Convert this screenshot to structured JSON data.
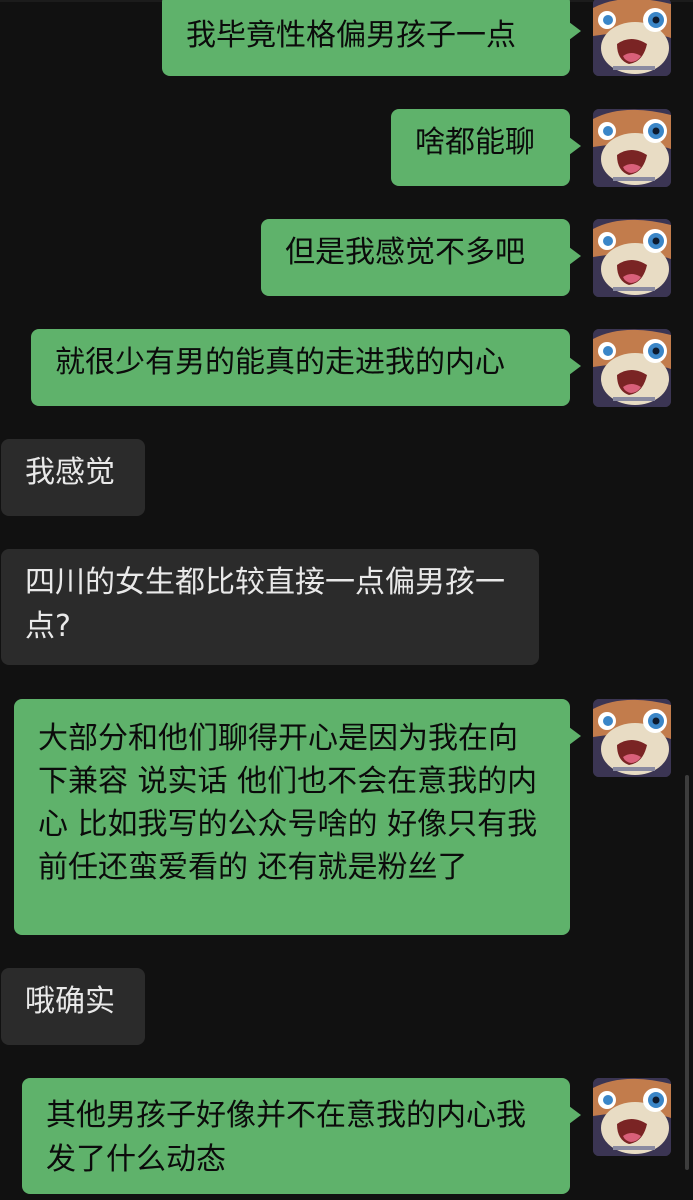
{
  "messages": [
    {
      "side": "out",
      "text": "我毕竟性格偏男孩子一点"
    },
    {
      "side": "out",
      "text": "啥都能聊"
    },
    {
      "side": "out",
      "text": "但是我感觉不多吧"
    },
    {
      "side": "out",
      "text": "就很少有男的能真的走进我的内心"
    },
    {
      "side": "in",
      "text": "我感觉"
    },
    {
      "side": "in",
      "text": "四川的女生都比较直接一点偏男孩一点?"
    },
    {
      "side": "out",
      "text": "大部分和他们聊得开心是因为我在向下兼容 说实话 他们也不会在意我的内心 比如我写的公众号啥的 好像只有我前任还蛮爱看的 还有就是粉丝了"
    },
    {
      "side": "in",
      "text": "哦确实"
    },
    {
      "side": "out",
      "text": "其他男孩子好像并不在意我的内心我发了什么动态"
    }
  ],
  "colors": {
    "background": "#111111",
    "outgoing_bubble": "#5fb26b",
    "incoming_bubble": "#2b2b2b",
    "incoming_text": "#e9e9e9",
    "outgoing_text": "#0b0b0b"
  },
  "avatar": {
    "icon": "cartoon-face-avatar-icon"
  }
}
